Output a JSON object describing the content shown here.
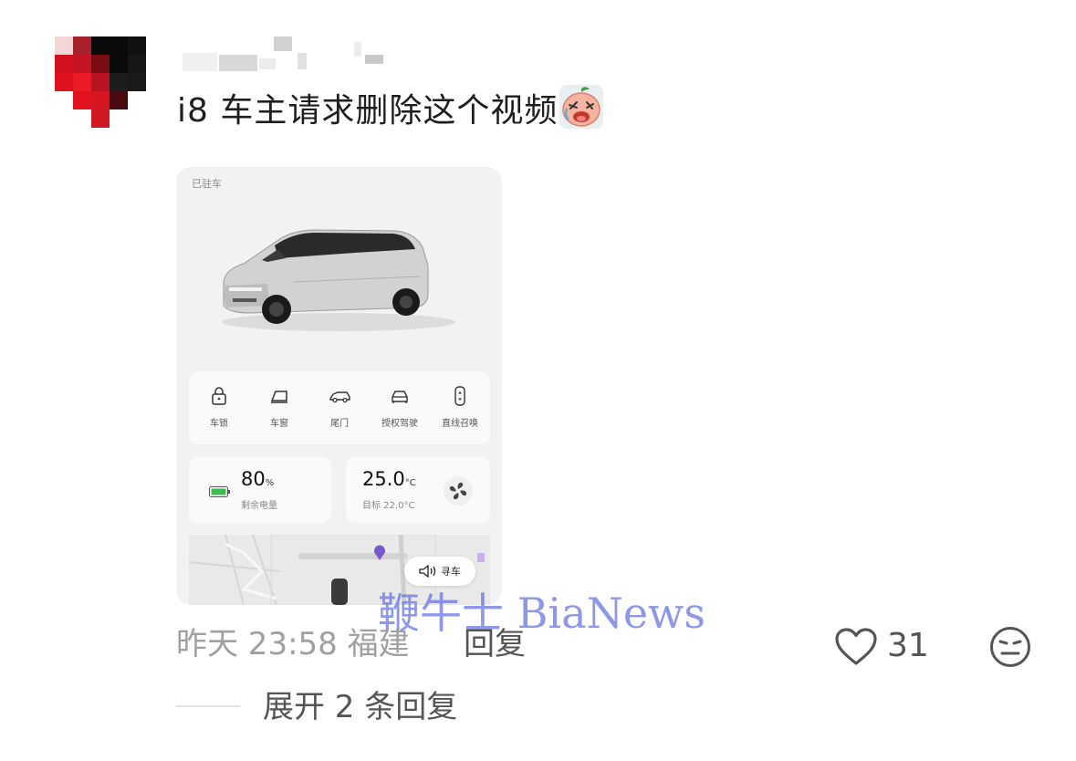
{
  "comment": {
    "text": "i8 车主请求删除这个视频",
    "emoji_icon": "crying-face-icon"
  },
  "screenshot_card": {
    "status": "已驻车",
    "quick_actions": [
      {
        "label": "车锁",
        "icon": "lock-icon"
      },
      {
        "label": "车窗",
        "icon": "window-icon"
      },
      {
        "label": "尾门",
        "icon": "tailgate-icon"
      },
      {
        "label": "授权驾驶",
        "icon": "authorized-driving-icon"
      },
      {
        "label": "直线召唤",
        "icon": "summon-icon"
      }
    ],
    "battery": {
      "value": "80",
      "unit": "%",
      "label": "剩余电量",
      "color": "#3fb950"
    },
    "climate": {
      "value": "25.0",
      "unit": "°C",
      "target": "目标 22.0°C"
    },
    "find_car": "寻车"
  },
  "watermark": "鞭牛士 BiaNews",
  "meta": {
    "time": "昨天 23:58",
    "location": "福建",
    "reply": "回复"
  },
  "likes": {
    "count": "31"
  },
  "expand_replies": "展开 2 条回复",
  "colors": {
    "watermark": "#6270e1",
    "meta_text": "#a0a0a0"
  }
}
